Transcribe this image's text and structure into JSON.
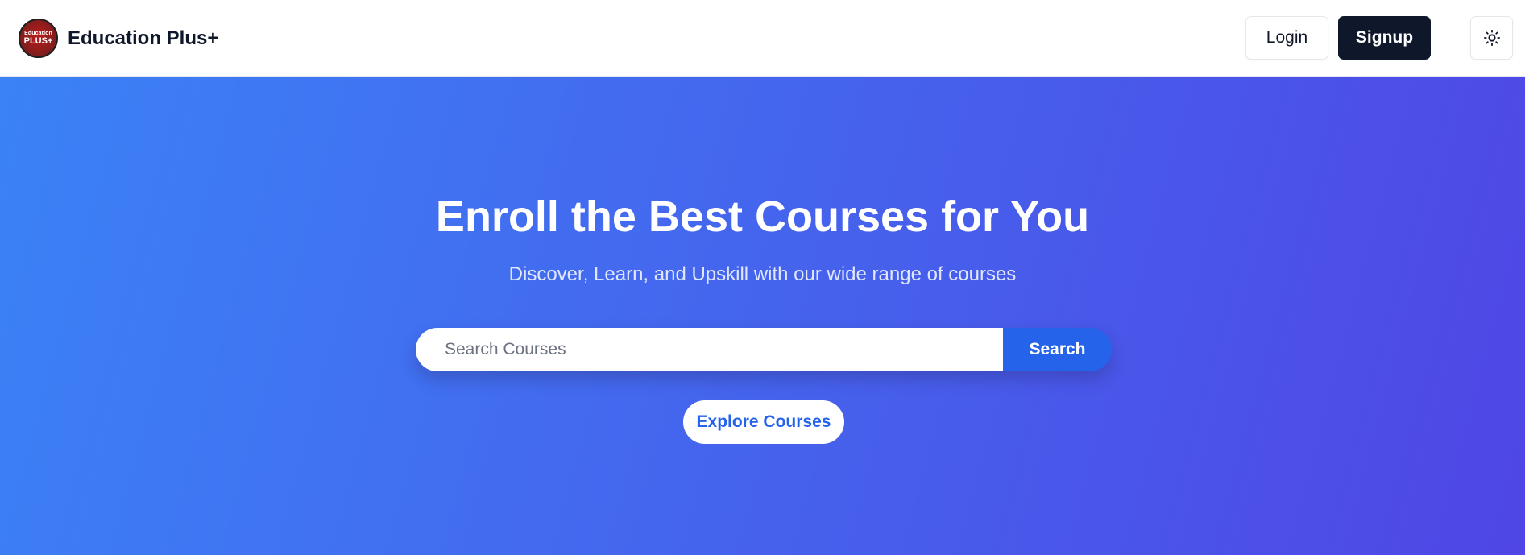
{
  "header": {
    "logo": {
      "line1": "Education",
      "line2": "PLUS+"
    },
    "brand_name": "Education Plus+",
    "login_label": "Login",
    "signup_label": "Signup",
    "theme_toggle_icon": "sun-icon"
  },
  "hero": {
    "title": "Enroll the Best Courses for You",
    "subtitle": "Discover, Learn, and Upskill with our wide range of courses",
    "search": {
      "placeholder": "Search Courses",
      "value": "",
      "button_label": "Search"
    },
    "explore_label": "Explore Courses"
  },
  "colors": {
    "hero_gradient_start": "#3b82f6",
    "hero_gradient_end": "#4f46e5",
    "signup_bg": "#0f172a",
    "search_button_bg": "#2563eb",
    "explore_text": "#2563eb"
  }
}
